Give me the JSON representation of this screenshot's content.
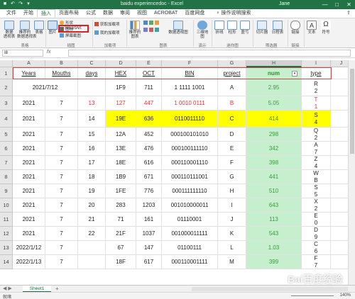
{
  "title_bar": {
    "title": "baidu experiencedoc - Excel",
    "user": "Jane",
    "minimize": "—",
    "restore": "□",
    "close": "✕",
    "color": "#217346"
  },
  "tabs": [
    "文件",
    "开始",
    "插入",
    "页面布局",
    "公式",
    "数据",
    "审阅",
    "视图",
    "ACROBAT",
    "百度网盘"
  ],
  "active_tab": "插入",
  "tell_me": "操作说明搜索",
  "share": "共享",
  "ribbon": {
    "pivot": "数据\n透视表",
    "recommended_pivot": "推荐的\n数据透视表",
    "table": "表格",
    "pictures": "图片",
    "shapes": "形状",
    "icons": "图标",
    "smartart": "SmartArt",
    "screenshot": "屏幕截图",
    "get_addins": "获取加载项",
    "my_addins": "我的加载项",
    "recommended_charts": "推荐的\n图表",
    "pivot_chart": "数据透视图",
    "map3d": "三维地\n图",
    "line": "折线",
    "column": "柱形",
    "winloss": "盈亏",
    "slicer": "切片器",
    "timeline": "日程表",
    "link": "链接",
    "text": "文本",
    "symbols": "符号",
    "groups": {
      "tables": "表格",
      "illustrations": "插图",
      "addins": "加载项",
      "charts": "图表",
      "tours": "演示",
      "sparklines": "迷你图",
      "filters": "筛选器",
      "links": "链接"
    }
  },
  "formula_bar": {
    "name_box": "I8",
    "fx": "fx",
    "value": ""
  },
  "columns": [
    "A",
    "B",
    "C",
    "D",
    "E",
    "F",
    "G",
    "H",
    "I",
    "J"
  ],
  "selected_column": "H",
  "rows": [
    {
      "n": "1",
      "cells": [
        "Years",
        "Mouths",
        "days",
        "HEX",
        "OCT",
        "BIN",
        "project",
        "num",
        "type",
        ""
      ]
    },
    {
      "n": "2",
      "cells": [
        "2021/7/12",
        "",
        "",
        "1F9",
        "711",
        "1 1111 1001",
        "A",
        "2.95",
        "R\n2",
        ""
      ]
    },
    {
      "n": "3",
      "cells": [
        "2021",
        "7",
        "13",
        "127",
        "447",
        "1 0010 0111",
        "B",
        "5.05",
        "T\n1",
        ""
      ]
    },
    {
      "n": "4",
      "cells": [
        "2021",
        "7",
        "14",
        "19E",
        "636",
        "0110011110",
        "C",
        "414",
        "S\n4",
        ""
      ]
    },
    {
      "n": "5",
      "cells": [
        "2021",
        "7",
        "15",
        "12A",
        "452",
        "000100101010",
        "D",
        "298",
        "Q\n2",
        ""
      ]
    },
    {
      "n": "6",
      "cells": [
        "2021",
        "7",
        "16",
        "13E",
        "476",
        "000100111110",
        "E",
        "342",
        "A\n7",
        ""
      ]
    },
    {
      "n": "7",
      "cells": [
        "2021",
        "7",
        "17",
        "18E",
        "616",
        "000110001110",
        "F",
        "398",
        "Z\n4",
        ""
      ]
    },
    {
      "n": "8",
      "cells": [
        "2021",
        "7",
        "18",
        "1B9",
        "671",
        "000110111001",
        "G",
        "441",
        "W\nB",
        ""
      ]
    },
    {
      "n": "9",
      "cells": [
        "2021",
        "7",
        "19",
        "1FE",
        "776",
        "000111111110",
        "H",
        "510",
        "S\n5",
        ""
      ]
    },
    {
      "n": "10",
      "cells": [
        "2021",
        "7",
        "20",
        "283",
        "1203",
        "001010000011",
        "I",
        "643",
        "X\n2",
        ""
      ]
    },
    {
      "n": "11",
      "cells": [
        "2021",
        "7",
        "21",
        "71",
        "161",
        "01110001",
        "J",
        "113",
        "E\n0",
        ""
      ]
    },
    {
      "n": "12",
      "cells": [
        "2021",
        "7",
        "22",
        "21F",
        "1037",
        "001000011111",
        "K",
        "543",
        "D\n9",
        ""
      ]
    },
    {
      "n": "13",
      "cells": [
        "2022/1/12",
        "7",
        "",
        "67",
        "147",
        "01100111",
        "L",
        "1.03",
        "C\n6",
        ""
      ]
    },
    {
      "n": "14",
      "cells": [
        "2022/1/13",
        "7",
        "",
        "18F",
        "617",
        "000110001111",
        "M",
        "399",
        "F\n7",
        ""
      ]
    }
  ],
  "sheet_tab": "Sheet1",
  "add_sheet": "+",
  "status": "就绪",
  "zoom": "140%",
  "watermark": "Bai百度经验",
  "colors": {
    "excel_green": "#217346",
    "yellow_highlight": "#ffff00",
    "green_column": "#c6efce",
    "red_text": "#e83030",
    "green_text": "#3a9a3a",
    "row1_border": "#c0504d"
  }
}
